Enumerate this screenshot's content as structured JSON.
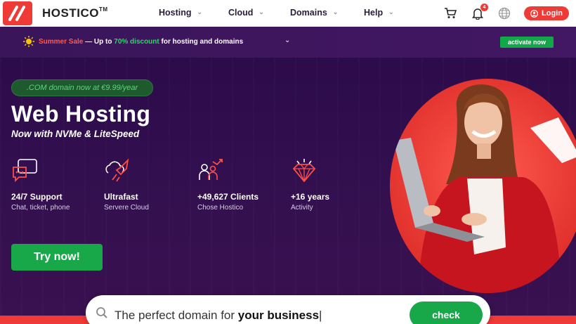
{
  "nav": {
    "brand": "HOSTICO",
    "brand_tm": "TM",
    "menu": [
      {
        "label": "Hosting"
      },
      {
        "label": "Cloud"
      },
      {
        "label": "Domains"
      },
      {
        "label": "Help"
      }
    ],
    "notification_count": "4",
    "login_label": "Login"
  },
  "promo": {
    "sale_label": "Summer Sale",
    "dash": " — Up to ",
    "discount": "70% discount",
    "rest": " for hosting and domains",
    "activate_label": "activate now"
  },
  "hero": {
    "pill": ".COM domain now at €9.99/year",
    "title": "Web Hosting",
    "subtitle": "Now with NVMe & LiteSpeed",
    "features": [
      {
        "title": "24/7 Support",
        "desc": "Chat, ticket, phone",
        "icon": "support-chat-icon"
      },
      {
        "title": "Ultrafast",
        "desc": "Servere Cloud",
        "icon": "cloud-rocket-icon"
      },
      {
        "title": "+49,627 Clients",
        "desc": "Chose Hostico",
        "icon": "clients-growth-icon"
      },
      {
        "title": "+16 years",
        "desc": "Activity",
        "icon": "diamond-icon"
      }
    ],
    "try_label": "Try now!"
  },
  "search": {
    "placeholder_prefix": "The perfect domain for ",
    "placeholder_bold": "your business",
    "check_label": "check"
  },
  "colors": {
    "accent_red": "#ee3b37",
    "accent_green": "#18a84a",
    "hero_bg": "#2d0c4c"
  }
}
